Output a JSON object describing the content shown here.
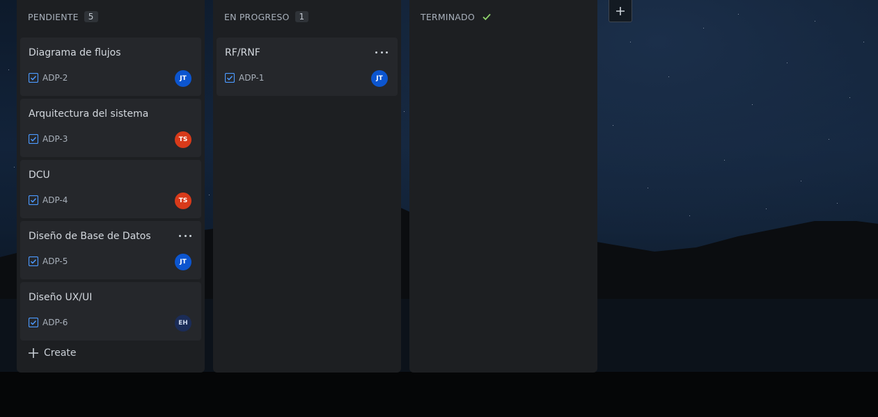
{
  "colors": {
    "avatar_jt": "#0c55cf",
    "avatar_ts": "#d83a1a",
    "avatar_eh": "#1b2c57",
    "check_green": "#8fd46b",
    "task_blue": "#4c9aff"
  },
  "icons": {
    "task": "checkbox-icon",
    "more": "ellipsis-icon",
    "create": "plus-icon",
    "add_column": "plus-icon",
    "done": "checkmark-icon"
  },
  "columns": [
    {
      "title": "PENDIENTE",
      "count": "5",
      "cards": [
        {
          "title": "Diagrama de flujos",
          "key": "ADP-2",
          "avatar": "JT"
        },
        {
          "title": "Arquitectura del sistema",
          "key": "ADP-3",
          "avatar": "TS"
        },
        {
          "title": "DCU",
          "key": "ADP-4",
          "avatar": "TS"
        },
        {
          "title": "Diseño de Base de Datos",
          "key": "ADP-5",
          "avatar": "JT"
        },
        {
          "title": "Diseño UX/UI",
          "key": "ADP-6",
          "avatar": "EH"
        }
      ],
      "create_label": "Create"
    },
    {
      "title": "EN PROGRESO",
      "count": "1",
      "cards": [
        {
          "title": "RF/RNF",
          "key": "ADP-1",
          "avatar": "JT"
        }
      ]
    },
    {
      "title": "TERMINADO"
    }
  ]
}
